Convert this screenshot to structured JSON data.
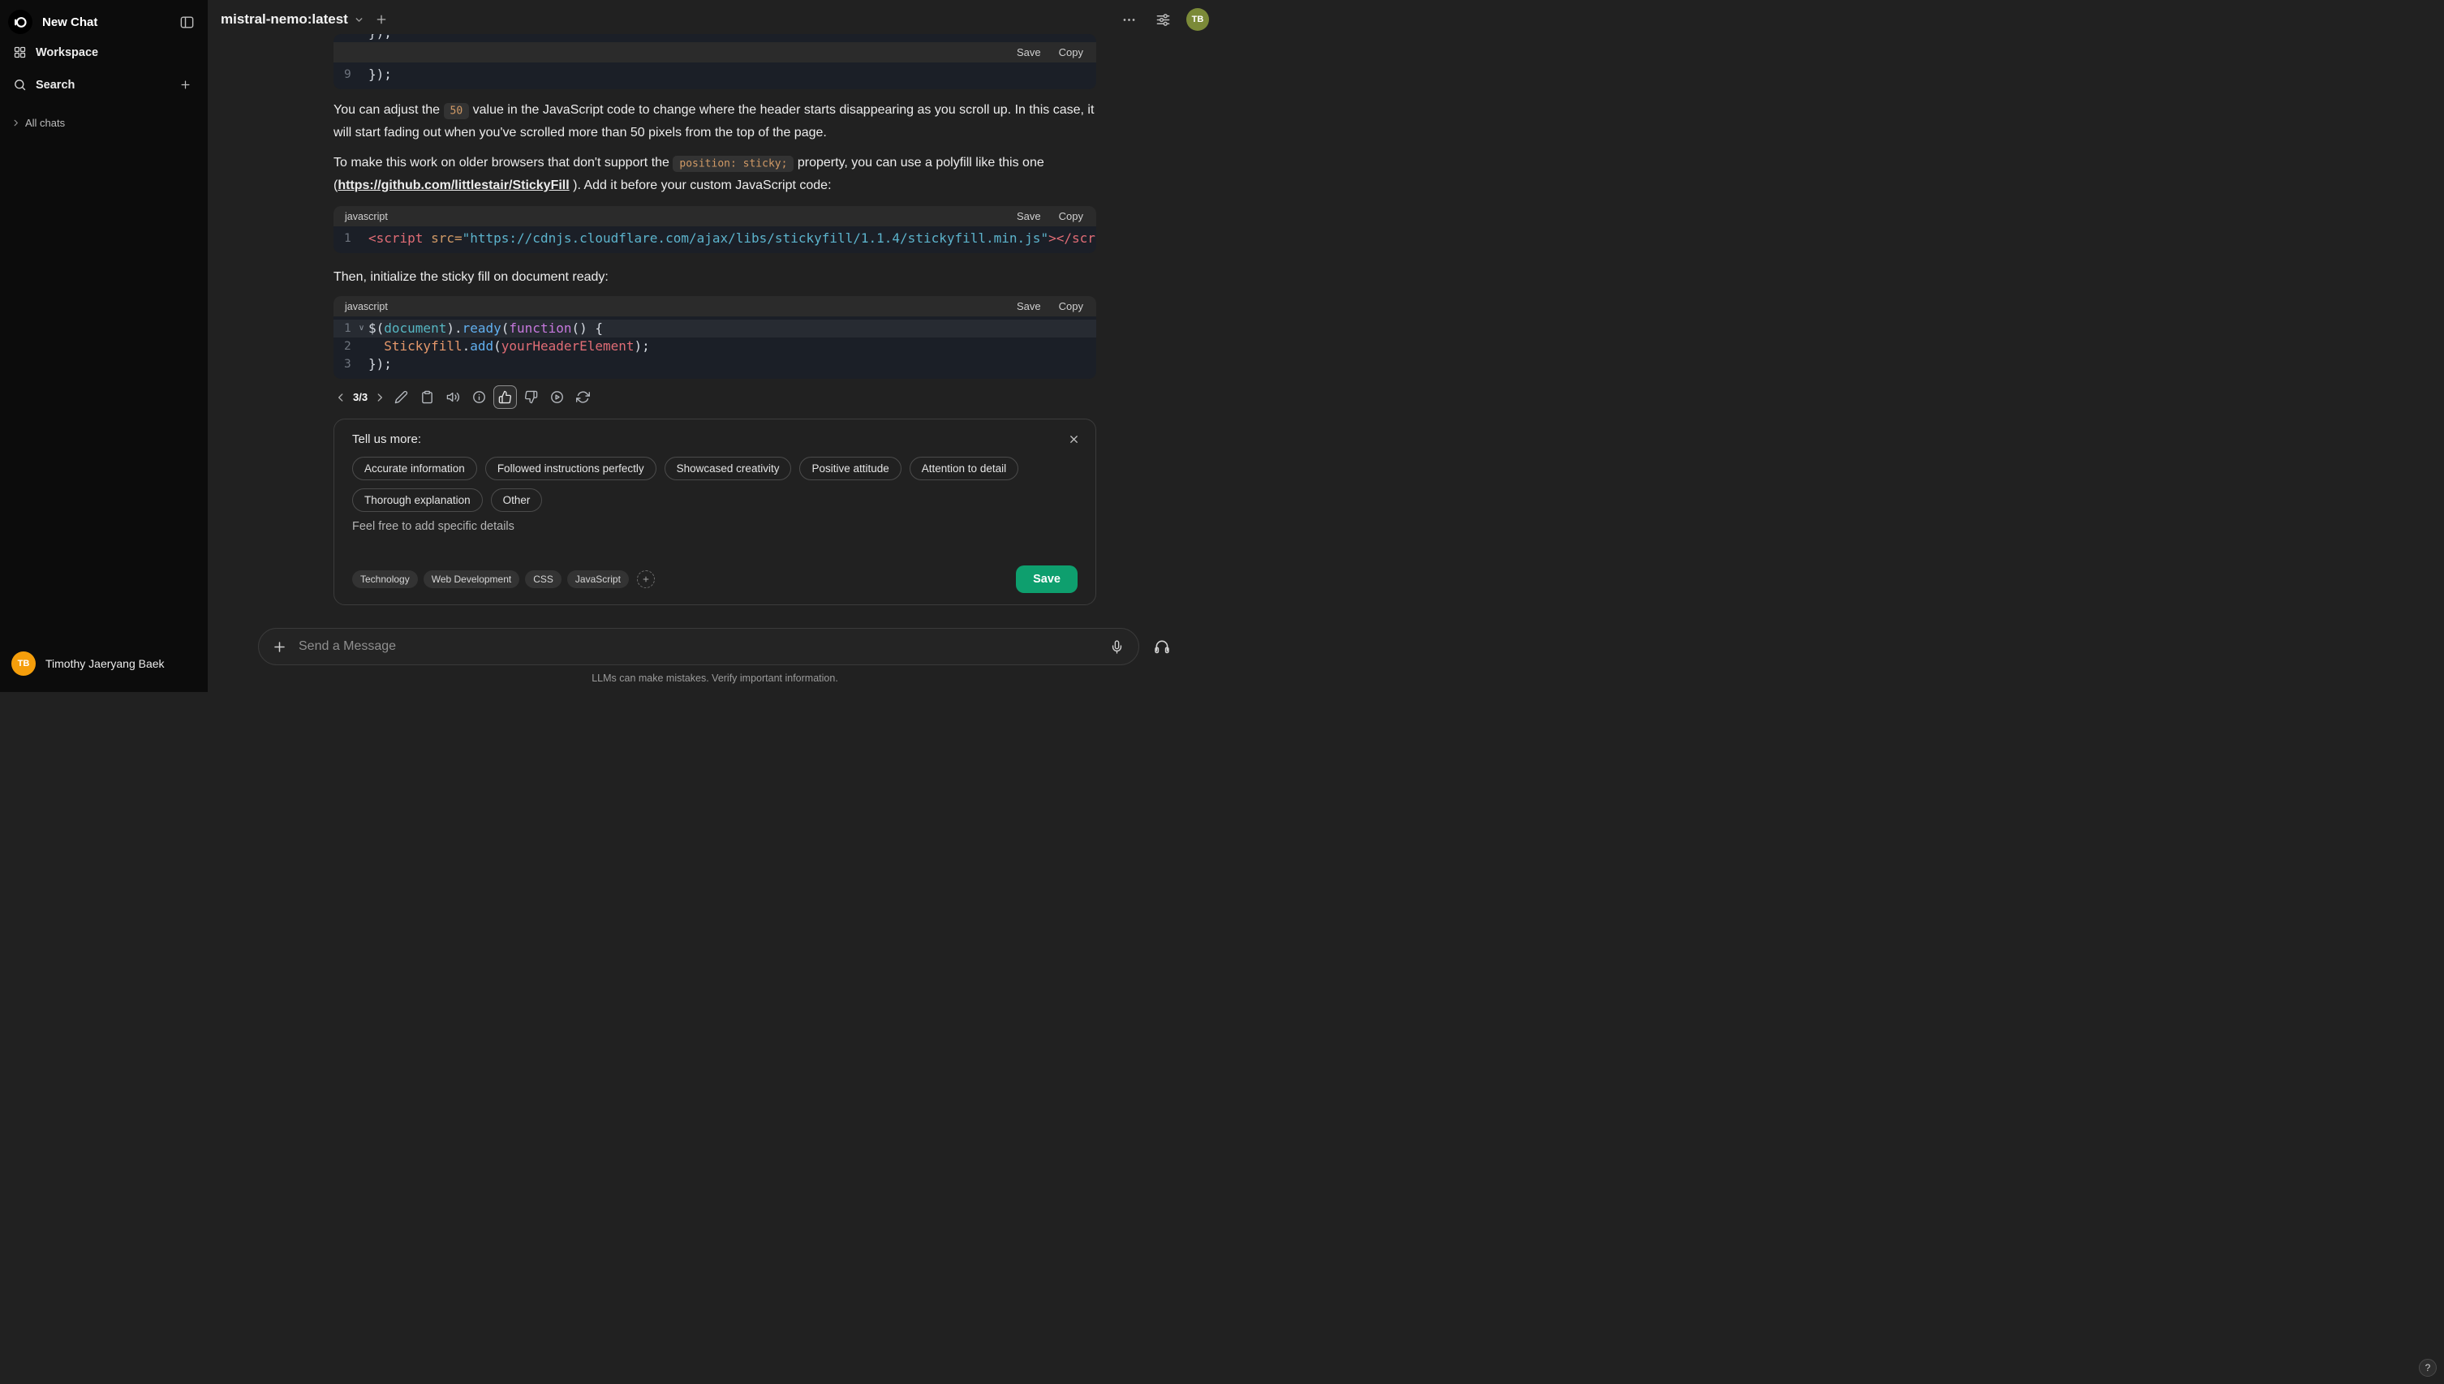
{
  "sidebar": {
    "new_chat": "New Chat",
    "workspace": "Workspace",
    "search": "Search",
    "all_chats": "All chats",
    "user": {
      "name": "Timothy Jaeryang Baek",
      "initials": "TB"
    }
  },
  "topbar": {
    "model": "mistral-nemo:latest",
    "user_initials": "TB"
  },
  "code_ui": {
    "save": "Save",
    "copy": "Copy"
  },
  "code_blocks": {
    "partial_above": {
      "lines": [
        {
          "no": "",
          "tokens": [
            {
              "text": "});",
              "type": "plain"
            }
          ]
        }
      ]
    },
    "partial": {
      "lines": [
        {
          "no": "9",
          "tokens": [
            {
              "text": "});",
              "type": "plain"
            }
          ]
        }
      ]
    },
    "polyfill": {
      "lang": "javascript",
      "lines": [
        {
          "no": "1",
          "tokens": [
            {
              "text": "<script",
              "type": "tag"
            },
            {
              "text": " ",
              "type": "plain"
            },
            {
              "text": "src=",
              "type": "attr"
            },
            {
              "text": "\"https://cdnjs.cloudflare.com/ajax/libs/stickyfill/1.1.4/stickyfill.min.js\"",
              "type": "string"
            },
            {
              "text": "></script>",
              "type": "tag"
            }
          ]
        }
      ]
    },
    "init": {
      "lang": "javascript",
      "lines": [
        {
          "no": "1",
          "fold": true,
          "highlight": true,
          "tokens": [
            {
              "text": "$(",
              "type": "plain"
            },
            {
              "text": "document",
              "type": "builtin"
            },
            {
              "text": ").",
              "type": "plain"
            },
            {
              "text": "ready",
              "type": "func"
            },
            {
              "text": "(",
              "type": "plain"
            },
            {
              "text": "function",
              "type": "keyword"
            },
            {
              "text": "() {",
              "type": "plain"
            }
          ]
        },
        {
          "no": "2",
          "tokens": [
            {
              "text": "  ",
              "type": "plain"
            },
            {
              "text": "Stickyfill",
              "type": "class"
            },
            {
              "text": ".",
              "type": "plain"
            },
            {
              "text": "add",
              "type": "func"
            },
            {
              "text": "(",
              "type": "plain"
            },
            {
              "text": "yourHeaderElement",
              "type": "var"
            },
            {
              "text": ");",
              "type": "plain"
            }
          ]
        },
        {
          "no": "3",
          "tokens": [
            {
              "text": "});",
              "type": "plain"
            }
          ]
        }
      ]
    }
  },
  "message": {
    "para1": {
      "t1": "You can adjust the ",
      "c1": "50",
      "t2": " value in the JavaScript code to change where the header starts disappearing as you scroll up. In this case, it will start fading out when you've scrolled more than 50 pixels from the top of the page."
    },
    "para2": {
      "t1": "To make this work on older browsers that don't support the ",
      "c1": "position: sticky;",
      "t2": " property, you can use a polyfill like this one (",
      "link": "https://github.com/littlestair/StickyFill",
      "t3": " ). Add it before your custom JavaScript code:"
    },
    "para3": "Then, initialize the sticky fill on document ready:",
    "nav_count": "3/3"
  },
  "feedback": {
    "title": "Tell us more:",
    "options": [
      "Accurate information",
      "Followed instructions perfectly",
      "Showcased creativity",
      "Positive attitude",
      "Attention to detail",
      "Thorough explanation",
      "Other"
    ],
    "comment_placeholder": "Feel free to add specific details",
    "tags": [
      "Technology",
      "Web Development",
      "CSS",
      "JavaScript"
    ],
    "save_label": "Save"
  },
  "composer": {
    "placeholder": "Send a Message"
  },
  "footer": {
    "disclaimer": "LLMs can make mistakes. Verify important information.",
    "help": "?"
  }
}
